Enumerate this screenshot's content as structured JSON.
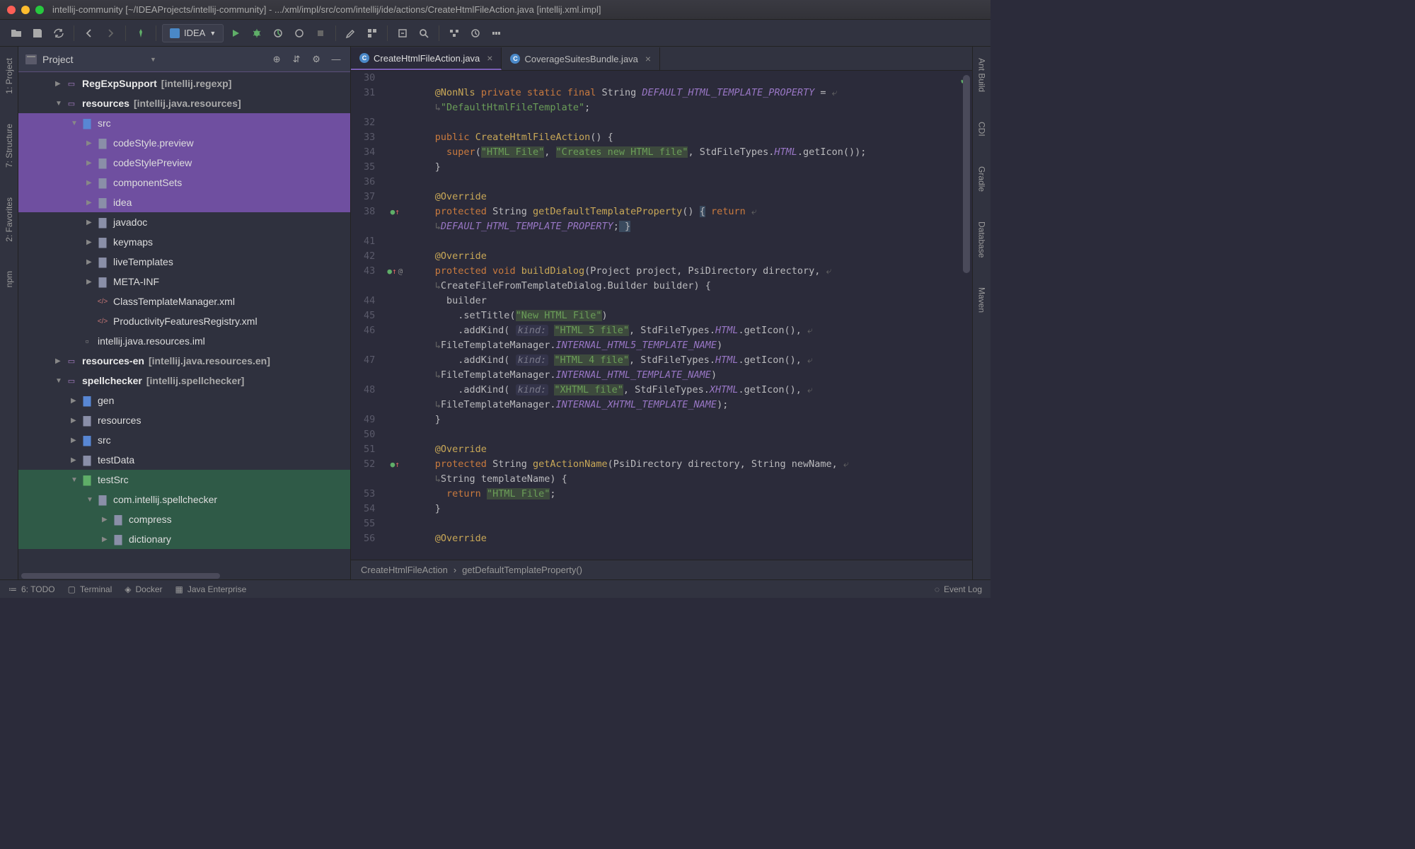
{
  "window": {
    "title": "intellij-community [~/IDEAProjects/intellij-community] - .../xml/impl/src/com/intellij/ide/actions/CreateHtmlFileAction.java [intellij.xml.impl]"
  },
  "toolbar": {
    "run_config_label": "IDEA"
  },
  "project": {
    "title": "Project",
    "tree": [
      {
        "indent": 2,
        "arrow": "▶",
        "icon": "module",
        "label": "RegExpSupport",
        "suffix": "[intellij.regexp]",
        "bold": true
      },
      {
        "indent": 2,
        "arrow": "▼",
        "icon": "module",
        "label": "resources",
        "suffix": "[intellij.java.resources]",
        "bold": true
      },
      {
        "indent": 3,
        "arrow": "▼",
        "icon": "folder-blue",
        "label": "src",
        "sel": "purple"
      },
      {
        "indent": 4,
        "arrow": "▶",
        "icon": "folder",
        "label": "codeStyle.preview",
        "sel": "purple"
      },
      {
        "indent": 4,
        "arrow": "▶",
        "icon": "folder",
        "label": "codeStylePreview",
        "sel": "purple"
      },
      {
        "indent": 4,
        "arrow": "▶",
        "icon": "folder",
        "label": "componentSets",
        "sel": "purple"
      },
      {
        "indent": 4,
        "arrow": "▶",
        "icon": "folder",
        "label": "idea",
        "sel": "purple"
      },
      {
        "indent": 4,
        "arrow": "▶",
        "icon": "folder",
        "label": "javadoc"
      },
      {
        "indent": 4,
        "arrow": "▶",
        "icon": "folder",
        "label": "keymaps"
      },
      {
        "indent": 4,
        "arrow": "▶",
        "icon": "folder",
        "label": "liveTemplates"
      },
      {
        "indent": 4,
        "arrow": "▶",
        "icon": "folder",
        "label": "META-INF"
      },
      {
        "indent": 4,
        "arrow": "",
        "icon": "xml",
        "label": "ClassTemplateManager.xml"
      },
      {
        "indent": 4,
        "arrow": "",
        "icon": "xml",
        "label": "ProductivityFeaturesRegistry.xml"
      },
      {
        "indent": 3,
        "arrow": "",
        "icon": "iml",
        "label": "intellij.java.resources.iml"
      },
      {
        "indent": 2,
        "arrow": "▶",
        "icon": "module",
        "label": "resources-en",
        "suffix": "[intellij.java.resources.en]",
        "bold": true
      },
      {
        "indent": 2,
        "arrow": "▼",
        "icon": "module",
        "label": "spellchecker",
        "suffix": "[intellij.spellchecker]",
        "bold": true
      },
      {
        "indent": 3,
        "arrow": "▶",
        "icon": "folder-blue-gear",
        "label": "gen"
      },
      {
        "indent": 3,
        "arrow": "▶",
        "icon": "folder",
        "label": "resources"
      },
      {
        "indent": 3,
        "arrow": "▶",
        "icon": "folder-blue",
        "label": "src"
      },
      {
        "indent": 3,
        "arrow": "▶",
        "icon": "folder",
        "label": "testData"
      },
      {
        "indent": 3,
        "arrow": "▼",
        "icon": "folder-green",
        "label": "testSrc",
        "sel": "green"
      },
      {
        "indent": 4,
        "arrow": "▼",
        "icon": "folder",
        "label": "com.intellij.spellchecker",
        "sel": "green"
      },
      {
        "indent": 5,
        "arrow": "▶",
        "icon": "folder",
        "label": "compress",
        "sel": "green"
      },
      {
        "indent": 5,
        "arrow": "▶",
        "icon": "folder",
        "label": "dictionary",
        "sel": "green"
      }
    ]
  },
  "tabs": [
    {
      "label": "CreateHtmlFileAction.java",
      "active": true
    },
    {
      "label": "CoverageSuitesBundle.java",
      "active": false
    }
  ],
  "left_tools": [
    "1: Project",
    "7: Structure",
    "2: Favorites",
    "npm"
  ],
  "right_tools": [
    "Ant Build",
    "CDI",
    "Gradle",
    "Database",
    "Maven"
  ],
  "gutter": {
    "lines": [
      "30",
      "31",
      "",
      "32",
      "33",
      "34",
      "35",
      "36",
      "37",
      "38",
      "",
      "41",
      "42",
      "43",
      "",
      "44",
      "45",
      "46",
      "",
      "47",
      "",
      "48",
      "",
      "49",
      "50",
      "51",
      "52",
      "",
      "53",
      "54",
      "55",
      "56"
    ],
    "marks": {
      "38": "●↑",
      "43": "●↑ @",
      "52": "●↑"
    }
  },
  "code": [
    {
      "n": "30",
      "html": ""
    },
    {
      "n": "31",
      "html": "<span class='k-ann'>@NonNls</span> <span class='k-kw'>private static final</span> String <span class='k-const'>DEFAULT_HTML_TEMPLATE_PROPERTY</span> = <span class='wrap-mark'>⤶</span>"
    },
    {
      "n": "",
      "html": "<span class='wrap-mark'>↳</span><span class='k-str'>\"DefaultHtmlFileTemplate\"</span>;"
    },
    {
      "n": "32",
      "html": ""
    },
    {
      "n": "33",
      "html": "<span class='k-kw'>public</span> <span class='k-method'>CreateHtmlFileAction</span>() {"
    },
    {
      "n": "34",
      "html": "  <span class='k-kw'>super</span>(<span class='k-lit'>\"HTML File\"</span>, <span class='k-lit'>\"Creates new HTML file\"</span>, StdFileTypes.<span class='k-const'>HTML</span>.getIcon());"
    },
    {
      "n": "35",
      "html": "}"
    },
    {
      "n": "36",
      "html": ""
    },
    {
      "n": "37",
      "html": "<span class='k-ann'>@Override</span>"
    },
    {
      "n": "38",
      "html": "<span class='k-kw'>protected</span> String <span class='k-method'>getDefaultTemplateProperty</span>() <span class='k-sel'>{</span> <span class='k-kw'>return</span> <span class='wrap-mark'>⤶</span>"
    },
    {
      "n": "",
      "html": "<span class='wrap-mark'>↳</span><span class='k-const'>DEFAULT_HTML_TEMPLATE_PROPERTY</span>;<span class='k-sel'> }</span>"
    },
    {
      "n": "41",
      "html": ""
    },
    {
      "n": "42",
      "html": "<span class='k-ann'>@Override</span>"
    },
    {
      "n": "43",
      "html": "<span class='k-kw'>protected void</span> <span class='k-method'>buildDialog</span>(Project project, PsiDirectory directory, <span class='wrap-mark'>⤶</span>"
    },
    {
      "n": "",
      "html": "<span class='wrap-mark'>↳</span>CreateFileFromTemplateDialog.Builder builder) {"
    },
    {
      "n": "44",
      "html": "  builder"
    },
    {
      "n": "45",
      "html": "    .setTitle(<span class='k-lit'>\"New HTML File\"</span>)"
    },
    {
      "n": "46",
      "html": "    .addKind( <span class='k-hint'>kind:</span> <span class='k-lit'>\"HTML 5 file\"</span>, StdFileTypes.<span class='k-const'>HTML</span>.getIcon(), <span class='wrap-mark'>⤶</span>"
    },
    {
      "n": "",
      "html": "<span class='wrap-mark'>↳</span>FileTemplateManager.<span class='k-const'>INTERNAL_HTML5_TEMPLATE_NAME</span>)"
    },
    {
      "n": "47",
      "html": "    .addKind( <span class='k-hint'>kind:</span> <span class='k-lit'>\"HTML 4 file\"</span>, StdFileTypes.<span class='k-const'>HTML</span>.getIcon(), <span class='wrap-mark'>⤶</span>"
    },
    {
      "n": "",
      "html": "<span class='wrap-mark'>↳</span>FileTemplateManager.<span class='k-const'>INTERNAL_HTML_TEMPLATE_NAME</span>)"
    },
    {
      "n": "48",
      "html": "    .addKind( <span class='k-hint'>kind:</span> <span class='k-lit'>\"XHTML file\"</span>, StdFileTypes.<span class='k-const'>XHTML</span>.getIcon(), <span class='wrap-mark'>⤶</span>"
    },
    {
      "n": "",
      "html": "<span class='wrap-mark'>↳</span>FileTemplateManager.<span class='k-const'>INTERNAL_XHTML_TEMPLATE_NAME</span>);"
    },
    {
      "n": "49",
      "html": "}"
    },
    {
      "n": "50",
      "html": ""
    },
    {
      "n": "51",
      "html": "<span class='k-ann'>@Override</span>"
    },
    {
      "n": "52",
      "html": "<span class='k-kw'>protected</span> String <span class='k-method'>getActionName</span>(PsiDirectory directory, String newName, <span class='wrap-mark'>⤶</span>"
    },
    {
      "n": "",
      "html": "<span class='wrap-mark'>↳</span>String templateName) {"
    },
    {
      "n": "53",
      "html": "  <span class='k-kw'>return</span> <span class='k-lit'>\"HTML File\"</span>;"
    },
    {
      "n": "54",
      "html": "}"
    },
    {
      "n": "55",
      "html": ""
    },
    {
      "n": "56",
      "html": "<span class='k-ann'>@Override</span>"
    }
  ],
  "breadcrumb": [
    "CreateHtmlFileAction",
    "getDefaultTemplateProperty()"
  ],
  "statusbar": {
    "todo": "6: TODO",
    "terminal": "Terminal",
    "docker": "Docker",
    "java_ee": "Java Enterprise",
    "event_log": "Event Log"
  }
}
